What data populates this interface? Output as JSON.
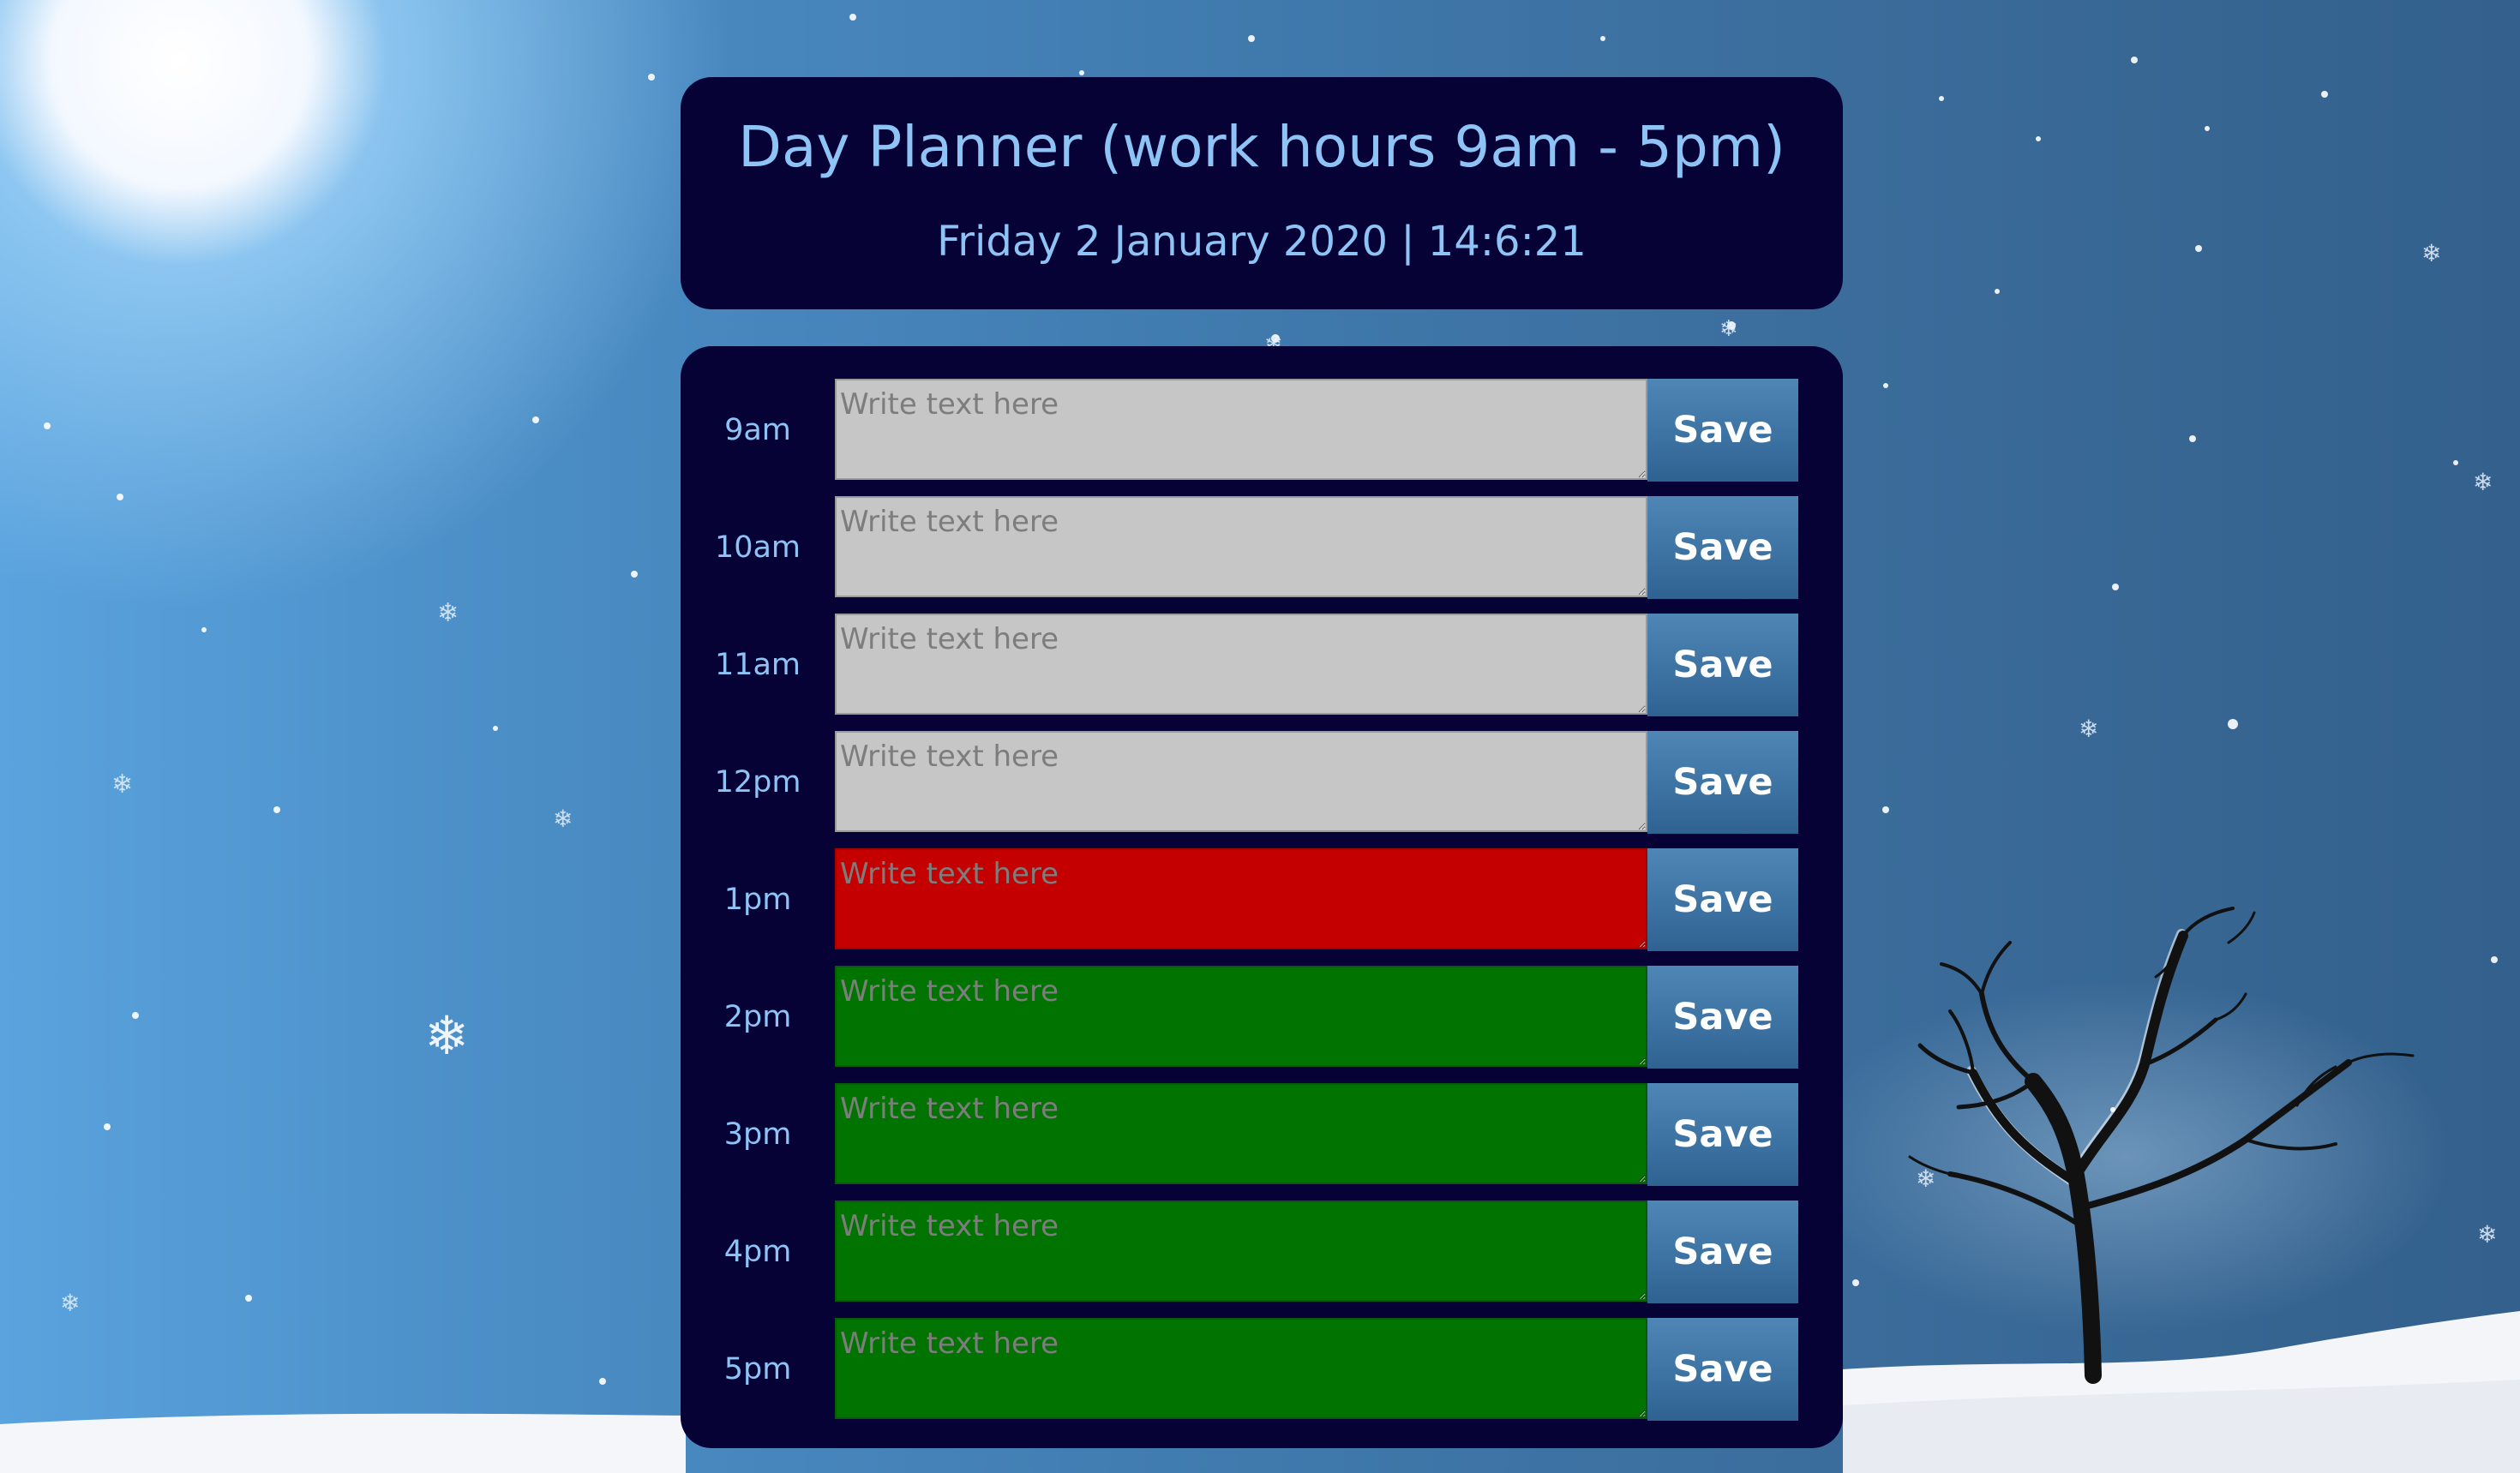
{
  "header": {
    "title": "Day Planner (work hours 9am - 5pm)",
    "datetime": "Friday 2 January 2020 | 14:6:21"
  },
  "planner": {
    "placeholder": "Write text here",
    "save_label": "Save",
    "colors": {
      "past": "#c6c6c6",
      "present": "#c40000",
      "future": "#007300",
      "panel": "#060235",
      "label": "#8ec3f5"
    },
    "rows": [
      {
        "hour": "9am",
        "state": "past",
        "value": ""
      },
      {
        "hour": "10am",
        "state": "past",
        "value": ""
      },
      {
        "hour": "11am",
        "state": "past",
        "value": ""
      },
      {
        "hour": "12pm",
        "state": "past",
        "value": ""
      },
      {
        "hour": "1pm",
        "state": "present",
        "value": ""
      },
      {
        "hour": "2pm",
        "state": "future",
        "value": ""
      },
      {
        "hour": "3pm",
        "state": "future",
        "value": ""
      },
      {
        "hour": "4pm",
        "state": "future",
        "value": ""
      },
      {
        "hour": "5pm",
        "state": "future",
        "value": ""
      }
    ]
  }
}
